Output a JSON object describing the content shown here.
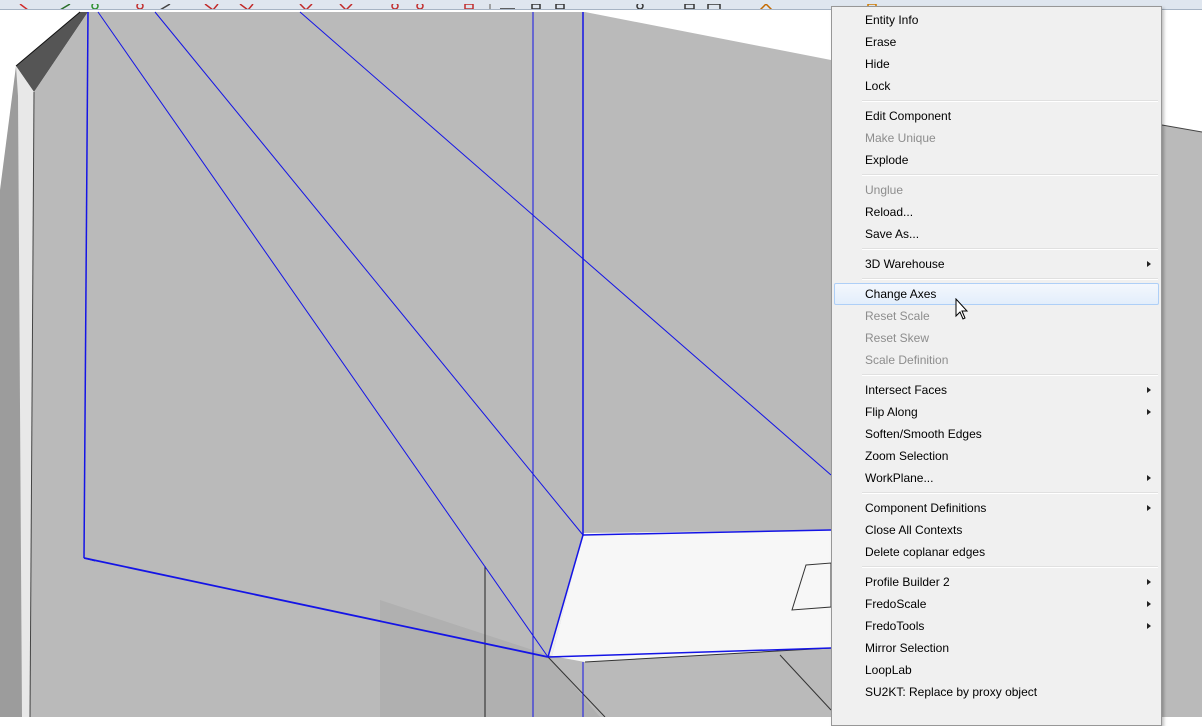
{
  "context_menu": {
    "items": [
      {
        "label": "Entity Info",
        "enabled": true,
        "submenu": false
      },
      {
        "label": "Erase",
        "enabled": true,
        "submenu": false
      },
      {
        "label": "Hide",
        "enabled": true,
        "submenu": false
      },
      {
        "label": "Lock",
        "enabled": true,
        "submenu": false
      },
      {
        "label": "Edit Component",
        "enabled": true,
        "submenu": false
      },
      {
        "label": "Make Unique",
        "enabled": false,
        "submenu": false
      },
      {
        "label": "Explode",
        "enabled": true,
        "submenu": false
      },
      {
        "label": "Unglue",
        "enabled": false,
        "submenu": false
      },
      {
        "label": "Reload...",
        "enabled": true,
        "submenu": false
      },
      {
        "label": "Save As...",
        "enabled": true,
        "submenu": false
      },
      {
        "label": "3D Warehouse",
        "enabled": true,
        "submenu": true
      },
      {
        "label": "Change Axes",
        "enabled": true,
        "submenu": false,
        "highlighted": true
      },
      {
        "label": "Reset Scale",
        "enabled": false,
        "submenu": false
      },
      {
        "label": "Reset Skew",
        "enabled": false,
        "submenu": false
      },
      {
        "label": "Scale Definition",
        "enabled": false,
        "submenu": false
      },
      {
        "label": "Intersect Faces",
        "enabled": true,
        "submenu": true
      },
      {
        "label": "Flip Along",
        "enabled": true,
        "submenu": true
      },
      {
        "label": "Soften/Smooth Edges",
        "enabled": true,
        "submenu": false
      },
      {
        "label": "Zoom Selection",
        "enabled": true,
        "submenu": false
      },
      {
        "label": "WorkPlane...",
        "enabled": true,
        "submenu": true
      },
      {
        "label": "Component Definitions",
        "enabled": true,
        "submenu": true
      },
      {
        "label": "Close All Contexts",
        "enabled": true,
        "submenu": false
      },
      {
        "label": "Delete coplanar edges",
        "enabled": true,
        "submenu": false
      },
      {
        "label": "Profile Builder 2",
        "enabled": true,
        "submenu": true
      },
      {
        "label": "FredoScale",
        "enabled": true,
        "submenu": true
      },
      {
        "label": "FredoTools",
        "enabled": true,
        "submenu": true
      },
      {
        "label": "Mirror Selection",
        "enabled": true,
        "submenu": false
      },
      {
        "label": "LoopLab",
        "enabled": true,
        "submenu": false
      },
      {
        "label": "SU2KT: Replace by proxy object",
        "enabled": true,
        "submenu": false
      }
    ]
  },
  "colors": {
    "selection_edge": "#1414e6",
    "face_gray": "#bababa",
    "face_light": "#f7f7f7",
    "menu_background": "#f0f0f0",
    "highlight_border": "#aecff7"
  },
  "icons": [
    "toolbar-icons",
    "mouse-pointer-icon",
    "submenu-arrow-icon"
  ]
}
